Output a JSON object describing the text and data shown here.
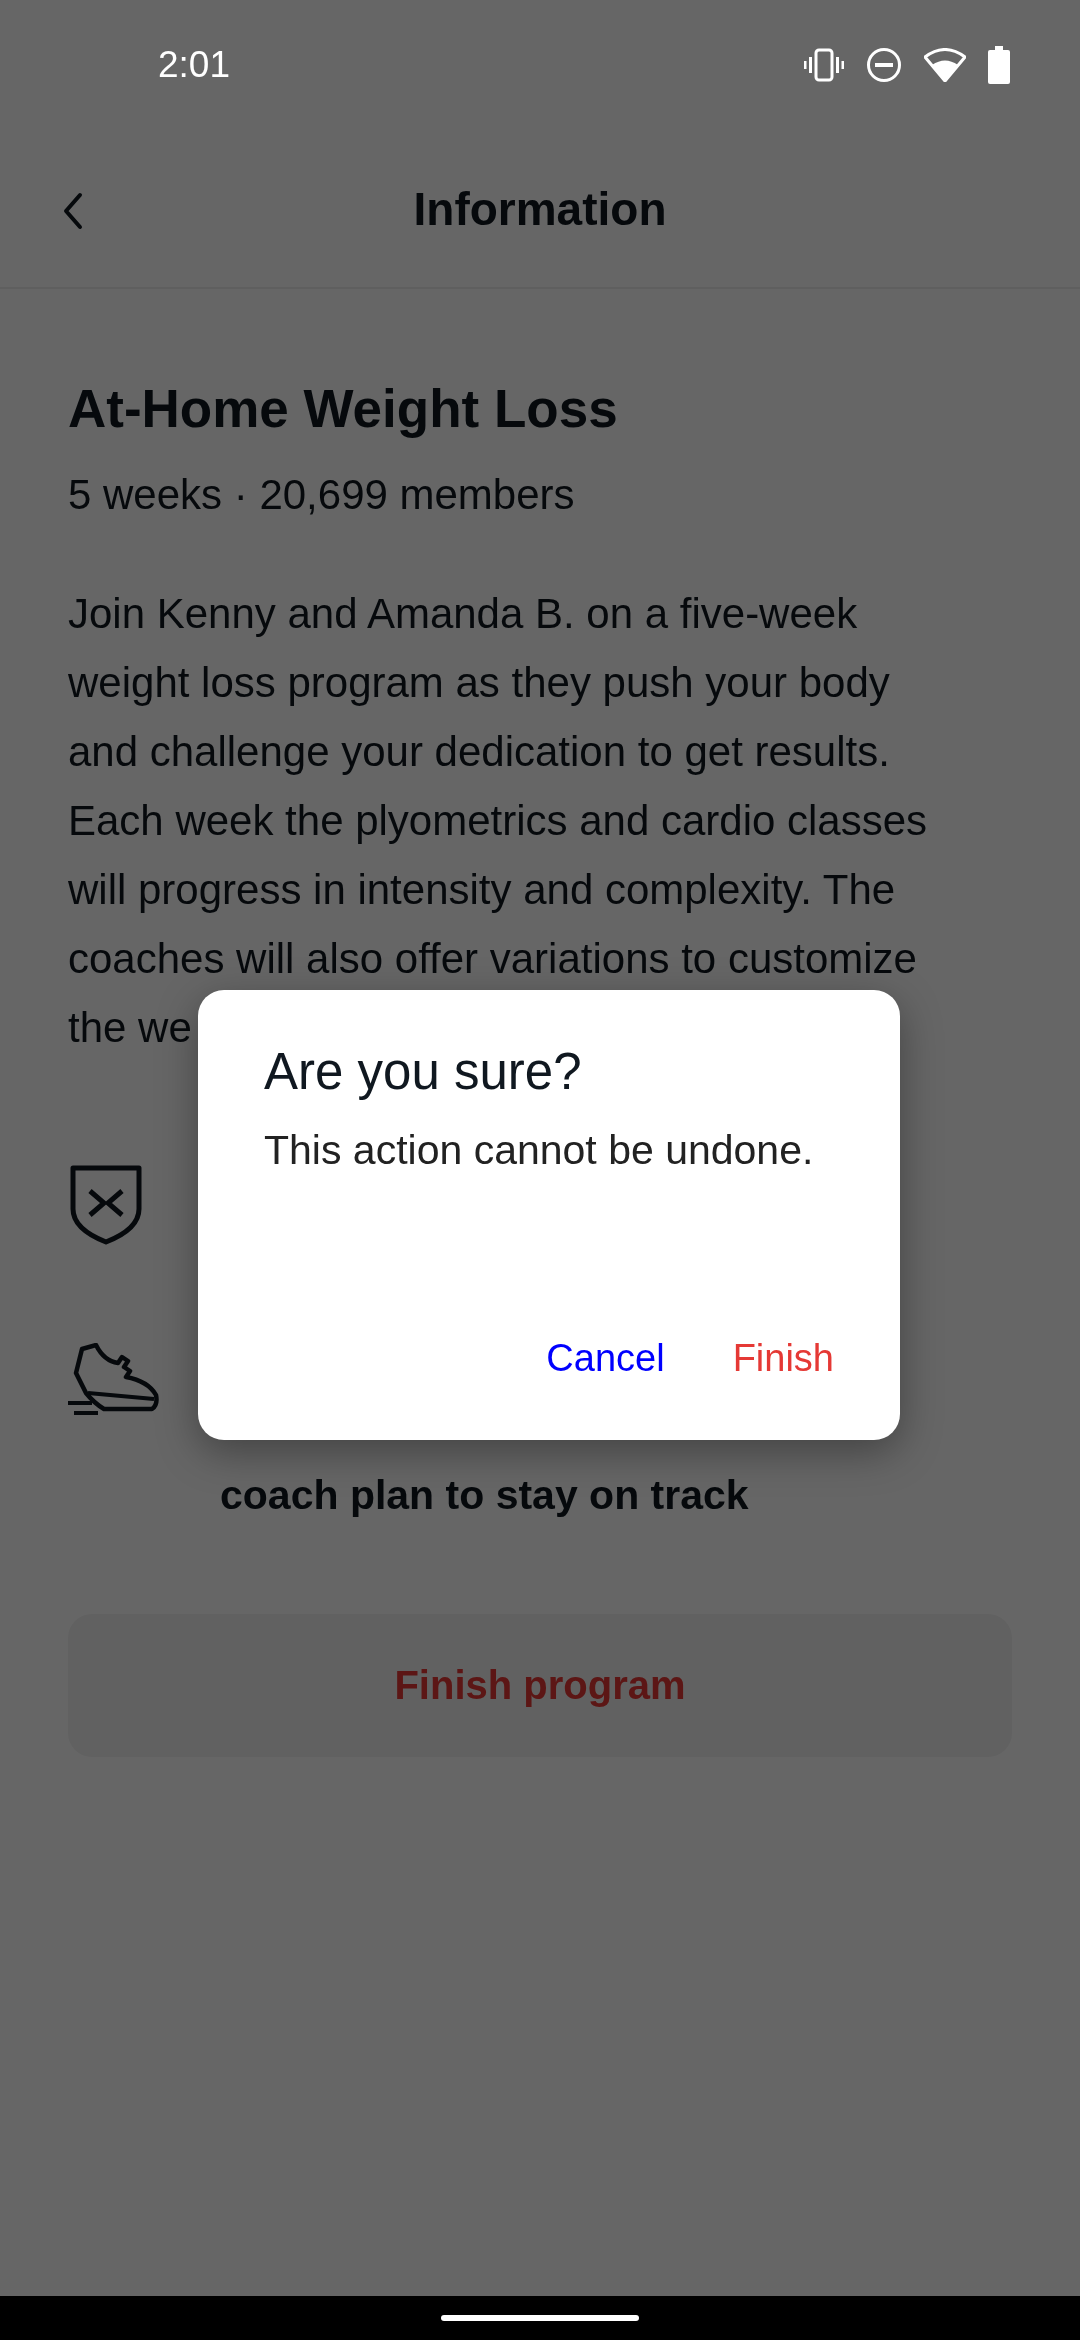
{
  "status_bar": {
    "time": "2:01"
  },
  "app_bar": {
    "title": "Information"
  },
  "program": {
    "title": "At-Home Weight Loss",
    "meta": "5 weeks · 20,699 members",
    "description": "Join Kenny and Amanda B. on a five-week\nweight loss program as they push your body\nand challenge your dedication to get results.\nEach week the plyometrics and cardio classes\nwill progress in intensity and complexity. The\ncoaches will also offer variations to customize\nthe we",
    "features": [
      {
        "kind": "shield"
      },
      {
        "kind": "shoe",
        "text": "coach plan to stay on track"
      }
    ],
    "finish_button": "Finish program"
  },
  "dialog": {
    "title": "Are you sure?",
    "message": "This action cannot be undone.",
    "buttons": [
      {
        "label": "Cancel",
        "kind": "cancel"
      },
      {
        "label": "Finish",
        "kind": "destructive"
      }
    ]
  }
}
